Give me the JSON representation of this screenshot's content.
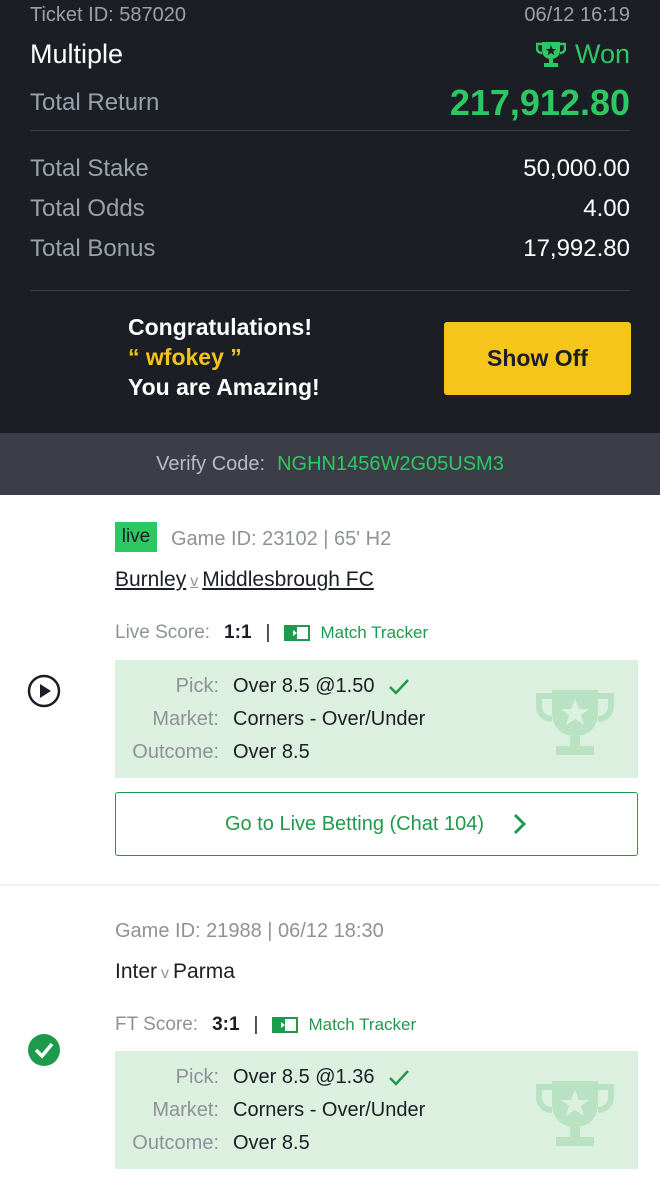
{
  "header": {
    "ticket_id": "Ticket ID: 587020",
    "datetime": "06/12 16:19",
    "bet_type": "Multiple",
    "status": "Won",
    "total_return_label": "Total Return",
    "total_return_value": "217,912.80",
    "total_stake_label": "Total Stake",
    "total_stake_value": "50,000.00",
    "total_odds_label": "Total Odds",
    "total_odds_value": "4.00",
    "total_bonus_label": "Total Bonus",
    "total_bonus_value": "17,992.80"
  },
  "congrats": {
    "line1": "Congratulations!",
    "username": "“ wfokey ”",
    "line3": "You are Amazing!",
    "button": "Show Off"
  },
  "verify": {
    "label": "Verify Code:",
    "code": "NGHN1456W2G05USM3"
  },
  "events": [
    {
      "live_badge": "live",
      "game_info": "Game ID: 23102 | 65' H2",
      "home": "Burnley",
      "v": "v",
      "away": "Middlesbrough FC",
      "score_label": "Live Score:",
      "score": "1:1",
      "sep": "|",
      "tracker": "Match Tracker",
      "pick_label": "Pick:",
      "pick_value": "Over 8.5 @1.50",
      "market_label": "Market:",
      "market_value": "Corners - Over/Under",
      "outcome_label": "Outcome:",
      "outcome_value": "Over 8.5",
      "go_live": "Go to Live Betting (Chat 104)"
    },
    {
      "game_info": "Game ID: 21988 | 06/12 18:30",
      "home": "Inter",
      "v": "v",
      "away": "Parma",
      "score_label": "FT Score:",
      "score": "3:1",
      "sep": "|",
      "tracker": "Match Tracker",
      "pick_label": "Pick:",
      "pick_value": "Over 8.5 @1.36",
      "market_label": "Market:",
      "market_value": "Corners - Over/Under",
      "outcome_label": "Outcome:",
      "outcome_value": "Over 8.5"
    }
  ],
  "colors": {
    "dark_bg": "#1b1e25",
    "green": "#2ec862",
    "yellow": "#f5c51b",
    "pick_bg": "#dbf0df"
  }
}
